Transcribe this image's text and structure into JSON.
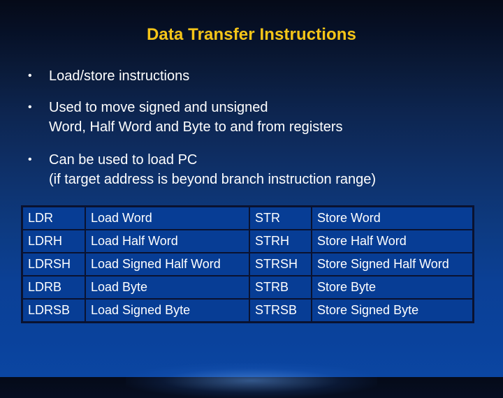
{
  "slide": {
    "title": "Data Transfer Instructions",
    "bullet_glyph": "•",
    "bullets": [
      {
        "lines": [
          "Load/store instructions"
        ]
      },
      {
        "lines": [
          "Used to move signed and unsigned",
          "Word, Half Word and Byte to and from registers"
        ]
      },
      {
        "lines": [
          "Can be used to load PC",
          "(if target address is beyond branch instruction range)"
        ]
      }
    ],
    "table": {
      "rows": [
        {
          "load_op": "LDR",
          "load_desc": "Load Word",
          "store_op": "STR",
          "store_desc": "Store Word"
        },
        {
          "load_op": "LDRH",
          "load_desc": "Load Half Word",
          "store_op": "STRH",
          "store_desc": "Store Half Word"
        },
        {
          "load_op": "LDRSH",
          "load_desc": "Load Signed Half Word",
          "store_op": "STRSH",
          "store_desc": "Store Signed Half Word"
        },
        {
          "load_op": "LDRB",
          "load_desc": "Load Byte",
          "store_op": "STRB",
          "store_desc": "Store Byte"
        },
        {
          "load_op": "LDRSB",
          "load_desc": "Load Signed Byte",
          "store_op": "STRSB",
          "store_desc": "Store Signed Byte"
        }
      ]
    },
    "colors": {
      "title": "#f5c518",
      "text": "#ffffff",
      "table_cell": "#073d95",
      "table_border": "#0a1230"
    }
  }
}
